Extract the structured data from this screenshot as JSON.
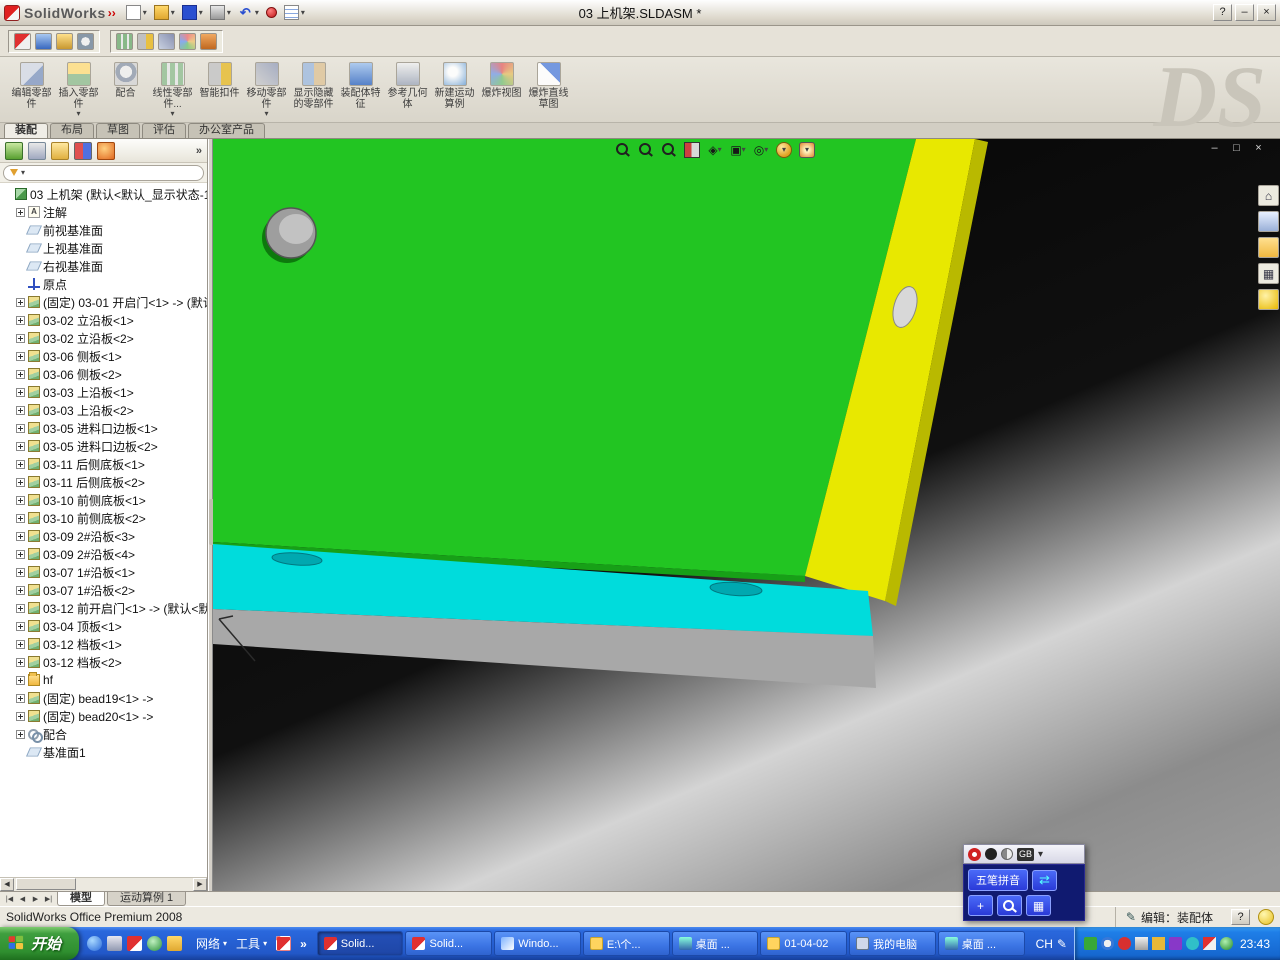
{
  "window": {
    "app_name": "SolidWorks",
    "title": "03 上机架.SLDASM *",
    "help": "?",
    "minimize": "–",
    "close": "×"
  },
  "title_toolbar": {
    "icons": [
      {
        "name": "new-document-icon",
        "cls": "qi-new",
        "caret": "show"
      },
      {
        "name": "open-icon",
        "cls": "qi-open",
        "caret": "show"
      },
      {
        "name": "save-icon",
        "cls": "qi-save",
        "caret": "show"
      },
      {
        "name": "print-icon",
        "cls": "qi-print",
        "caret": "show"
      },
      {
        "name": "undo-icon",
        "cls": "qi-undo",
        "caret": "show"
      },
      {
        "name": "record-macro-icon",
        "cls": "qi-record",
        "caret": ""
      },
      {
        "name": "options-icon",
        "cls": "qi-note",
        "caret": "show"
      }
    ]
  },
  "toolbar2": {
    "group1": [
      {
        "name": "select-icon",
        "cls": "si-1"
      },
      {
        "name": "edit-component-icon",
        "cls": "si-2"
      },
      {
        "name": "insert-component-icon",
        "cls": "si-3"
      },
      {
        "name": "mate-icon",
        "cls": "si-4"
      }
    ],
    "group2": [
      {
        "name": "component-pattern-icon",
        "cls": "si-5"
      },
      {
        "name": "smart-fasteners-icon",
        "cls": "si-6"
      },
      {
        "name": "move-component-icon",
        "cls": "si-7"
      },
      {
        "name": "exploded-view-icon",
        "cls": "si-8"
      },
      {
        "name": "interference-detection-icon",
        "cls": "si-9"
      }
    ]
  },
  "command_manager": {
    "watermark": "DS",
    "buttons": [
      {
        "label": "编辑零部件",
        "icon": "cmi-edit",
        "cls": ""
      },
      {
        "label": "插入零部件",
        "icon": "cmi-insert",
        "cls": "caret"
      },
      {
        "label": "配合",
        "icon": "cmi-mate",
        "cls": ""
      },
      {
        "label": "线性零部件...",
        "icon": "cmi-pattern",
        "cls": "caret"
      },
      {
        "label": "智能扣件",
        "icon": "cmi-fastener",
        "cls": ""
      },
      {
        "label": "移动零部件",
        "icon": "cmi-move",
        "cls": "caret"
      },
      {
        "label": "显示隐藏的零部件",
        "icon": "cmi-showhide",
        "cls": ""
      },
      {
        "label": "装配体特征",
        "icon": "cmi-feature",
        "cls": ""
      },
      {
        "label": "参考几何体",
        "icon": "cmi-refgeo",
        "cls": ""
      },
      {
        "label": "新建运动算例",
        "icon": "cmi-motion",
        "cls": ""
      },
      {
        "label": "爆炸视图",
        "icon": "cmi-explode",
        "cls": ""
      },
      {
        "label": "爆炸直线草图",
        "icon": "cmi-sketch",
        "cls": ""
      }
    ],
    "tabs": [
      {
        "label": "装配",
        "cls": "active"
      },
      {
        "label": "布局",
        "cls": ""
      },
      {
        "label": "草图",
        "cls": ""
      },
      {
        "label": "评估",
        "cls": ""
      },
      {
        "label": "办公室产品",
        "cls": ""
      }
    ]
  },
  "feature_panel": {
    "tabs": [
      {
        "name": "feature-tree-icon",
        "cls": "fm-1"
      },
      {
        "name": "property-manager-icon",
        "cls": "fm-2"
      },
      {
        "name": "configuration-manager-icon",
        "cls": "fm-3"
      },
      {
        "name": "dimxpert-icon",
        "cls": "fm-4"
      },
      {
        "name": "display-manager-icon",
        "cls": "fm-5"
      }
    ],
    "more": "»",
    "scroll_left": "◀",
    "scroll_right": "▶",
    "tree": [
      {
        "cls": "lvl0 noexp",
        "icon": "tico-asm",
        "label": "03 上机架 (默认<默认_显示状态-1"
      },
      {
        "cls": "",
        "icon": "tico-note",
        "label": "注解"
      },
      {
        "cls": "noexp",
        "icon": "tico-plane",
        "label": "前视基准面"
      },
      {
        "cls": "noexp",
        "icon": "tico-plane",
        "label": "上视基准面"
      },
      {
        "cls": "noexp",
        "icon": "tico-plane",
        "label": "右视基准面"
      },
      {
        "cls": "noexp",
        "icon": "tico-origin",
        "label": "原点"
      },
      {
        "cls": "",
        "icon": "tico-part",
        "label": "(固定) 03-01 开启门<1> -> (默认"
      },
      {
        "cls": "",
        "icon": "tico-part",
        "label": "03-02 立沿板<1>"
      },
      {
        "cls": "",
        "icon": "tico-part",
        "label": "03-02 立沿板<2>"
      },
      {
        "cls": "",
        "icon": "tico-part",
        "label": "03-06 侧板<1>"
      },
      {
        "cls": "",
        "icon": "tico-part",
        "label": "03-06 侧板<2>"
      },
      {
        "cls": "",
        "icon": "tico-part",
        "label": "03-03 上沿板<1>"
      },
      {
        "cls": "",
        "icon": "tico-part",
        "label": "03-03 上沿板<2>"
      },
      {
        "cls": "",
        "icon": "tico-part",
        "label": "03-05 进料口边板<1>"
      },
      {
        "cls": "",
        "icon": "tico-part",
        "label": "03-05 进料口边板<2>"
      },
      {
        "cls": "",
        "icon": "tico-part",
        "label": "03-11 后侧底板<1>"
      },
      {
        "cls": "",
        "icon": "tico-part",
        "label": "03-11 后侧底板<2>"
      },
      {
        "cls": "",
        "icon": "tico-part",
        "label": "03-10 前侧底板<1>"
      },
      {
        "cls": "",
        "icon": "tico-part",
        "label": "03-10 前侧底板<2>"
      },
      {
        "cls": "",
        "icon": "tico-part",
        "label": "03-09 2#沿板<3>"
      },
      {
        "cls": "",
        "icon": "tico-part",
        "label": "03-09 2#沿板<4>"
      },
      {
        "cls": "",
        "icon": "tico-part",
        "label": "03-07 1#沿板<1>"
      },
      {
        "cls": "",
        "icon": "tico-part",
        "label": "03-07 1#沿板<2>"
      },
      {
        "cls": "",
        "icon": "tico-part",
        "label": "03-12 前开启门<1> -> (默认<默"
      },
      {
        "cls": "",
        "icon": "tico-part",
        "label": "03-04 顶板<1>"
      },
      {
        "cls": "",
        "icon": "tico-part",
        "label": "03-12 档板<1>"
      },
      {
        "cls": "",
        "icon": "tico-part",
        "label": "03-12 档板<2>"
      },
      {
        "cls": "",
        "icon": "tico-folder",
        "label": "hf"
      },
      {
        "cls": "",
        "icon": "tico-part",
        "label": "(固定) bead19<1> ->"
      },
      {
        "cls": "",
        "icon": "tico-part",
        "label": "(固定) bead20<1> ->"
      },
      {
        "cls": "",
        "icon": "tico-mate",
        "label": "配合"
      },
      {
        "cls": "noexp",
        "icon": "tico-plane",
        "label": "基准面1"
      }
    ]
  },
  "viewport": {
    "colors": {
      "panel_green": "#22c522",
      "strip_yellow": "#e8e800",
      "strip_cyan": "#00dcdc",
      "strip_gray": "#a8a8a8"
    },
    "hud_icons": [
      {
        "name": "zoom-fit-icon",
        "cls": "hud-mag",
        "glyph": "",
        "caret": ""
      },
      {
        "name": "zoom-area-icon",
        "cls": "hud-mag",
        "glyph": "",
        "caret": ""
      },
      {
        "name": "zoom-in-out-icon",
        "cls": "hud-mag",
        "glyph": "",
        "caret": ""
      },
      {
        "name": "section-view-icon",
        "cls": "hud-section",
        "glyph": "",
        "caret": ""
      },
      {
        "name": "view-orientation-icon",
        "cls": "",
        "glyph": "◈",
        "caret": "show"
      },
      {
        "name": "display-style-icon",
        "cls": "",
        "glyph": "▣",
        "caret": "show"
      },
      {
        "name": "hide-show-items-icon",
        "cls": "",
        "glyph": "◎",
        "caret": "show"
      },
      {
        "name": "edit-appearance-icon",
        "cls": "hud-ball",
        "glyph": "",
        "caret": "show"
      },
      {
        "name": "view-settings-icon",
        "cls": "hud-scene",
        "glyph": "",
        "caret": "show"
      }
    ],
    "doc_controls": [
      {
        "name": "document-minimize-button",
        "glyph": "–"
      },
      {
        "name": "document-restore-button",
        "glyph": "□"
      },
      {
        "name": "document-close-button",
        "glyph": "×"
      }
    ]
  },
  "task_pane": {
    "icons": [
      {
        "name": "solidworks-resources-icon",
        "cls": "",
        "glyph": "⌂"
      },
      {
        "name": "design-library-icon",
        "cls": "tp-lib",
        "glyph": ""
      },
      {
        "name": "file-explorer-icon",
        "cls": "tp-folder",
        "glyph": ""
      },
      {
        "name": "view-palette-icon",
        "cls": "",
        "glyph": "▦"
      },
      {
        "name": "appearances-icon",
        "cls": "tp-ball",
        "glyph": ""
      }
    ]
  },
  "model_tabs": {
    "nav": [
      "|◀",
      "◀",
      "▶",
      "▶|"
    ],
    "tabs": [
      {
        "label": "模型",
        "cls": "active"
      },
      {
        "label": "运动算例 1",
        "cls": ""
      }
    ]
  },
  "status_bar": {
    "left": "SolidWorks Office Premium 2008",
    "edit_label": "编辑：装配体",
    "help": "?"
  },
  "taskbar": {
    "start": "开始",
    "toolbars": [
      {
        "label": "网络"
      },
      {
        "label": "工具"
      }
    ],
    "overflow": "»",
    "quick_launch": [
      {
        "cls": "ql-1"
      },
      {
        "cls": "ql-2"
      },
      {
        "cls": "ql-3"
      },
      {
        "cls": "ql-4"
      },
      {
        "cls": "ql-5"
      }
    ],
    "buttons": [
      {
        "label": "Solid...",
        "icon": "wbi-sw",
        "cls": "pressed"
      },
      {
        "label": "Solid...",
        "icon": "wbi-sw",
        "cls": ""
      },
      {
        "label": "Windo...",
        "icon": "wbi-win",
        "cls": ""
      },
      {
        "label": "E:\\个...",
        "icon": "wbi-folder",
        "cls": ""
      },
      {
        "label": "桌面 ...",
        "icon": "wbi-desk",
        "cls": ""
      },
      {
        "label": "01-04-02",
        "icon": "wbi-folder",
        "cls": ""
      },
      {
        "label": "我的电脑",
        "icon": "wbi-comp",
        "cls": ""
      },
      {
        "label": "桌面 ...",
        "icon": "wbi-desk",
        "cls": ""
      }
    ],
    "language": "CH",
    "tray": [
      {
        "cls": "tri-1"
      },
      {
        "cls": "tri-2"
      },
      {
        "cls": "tri-3"
      },
      {
        "cls": "tri-4"
      },
      {
        "cls": "tri-5"
      },
      {
        "cls": "tri-6"
      },
      {
        "cls": "tri-7"
      },
      {
        "cls": "tri-8"
      },
      {
        "cls": "tri-9"
      }
    ],
    "clock": "23:43"
  },
  "ime": {
    "top_icons": [
      {
        "name": "ime-logo-icon",
        "cls": "ime-logo",
        "glyph": ""
      },
      {
        "name": "ime-mode-icon",
        "cls": "ime-dot",
        "glyph": ""
      },
      {
        "name": "ime-halfwidth-icon",
        "cls": "ime-half",
        "glyph": ""
      },
      {
        "name": "ime-gb-icon",
        "cls": "ime-gb",
        "glyph": "GB"
      },
      {
        "name": "ime-caret-icon",
        "cls": "",
        "glyph": "▾"
      }
    ],
    "input_button": "五笔拼音",
    "swap": "⇄",
    "tools": [
      {
        "name": "ime-add-icon",
        "cls": "",
        "glyph": "+"
      },
      {
        "name": "ime-search-icon",
        "cls": "ime-mag",
        "glyph": ""
      },
      {
        "name": "ime-keyboard-icon",
        "cls": "",
        "glyph": "▦"
      }
    ]
  }
}
